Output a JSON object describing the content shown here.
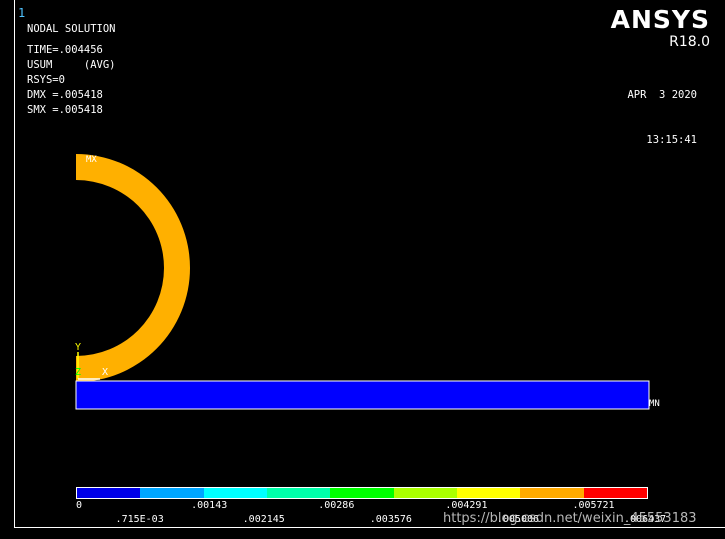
{
  "window_number": "1",
  "info": {
    "title": "NODAL SOLUTION",
    "time": "TIME=.004456",
    "usum": "USUM     (AVG)",
    "rsys": "RSYS=0",
    "dmx": "DMX =.005418",
    "smx": "SMX =.005418"
  },
  "brand": {
    "logo": "ANSYS",
    "version": "R18.0"
  },
  "datetime": {
    "date": "APR  3 2020",
    "time": "13:15:41"
  },
  "model_labels": {
    "max": "MX",
    "min": "MN"
  },
  "triad": {
    "y": "Y",
    "z": "Z",
    "x": "X"
  },
  "colors": {
    "ring": "#ffb000",
    "beam": "#0000ff",
    "axis_y": "#ffff00",
    "axis_z": "#00ff00",
    "axis_x": "#ffffff"
  },
  "legend": {
    "colors": [
      "#0000e8",
      "#00a6ff",
      "#00ffff",
      "#00ffaa",
      "#00ff00",
      "#aaff00",
      "#ffff00",
      "#ffaa00",
      "#ff0000"
    ],
    "top_labels": [
      "0",
      ".00143",
      ".00286",
      ".004291",
      ".005721"
    ],
    "bottom_labels": [
      ".715E-03",
      ".002145",
      ".003576",
      ".005006",
      ".006437"
    ]
  },
  "watermark": "https://blog.csdn.net/weixin_45553183"
}
